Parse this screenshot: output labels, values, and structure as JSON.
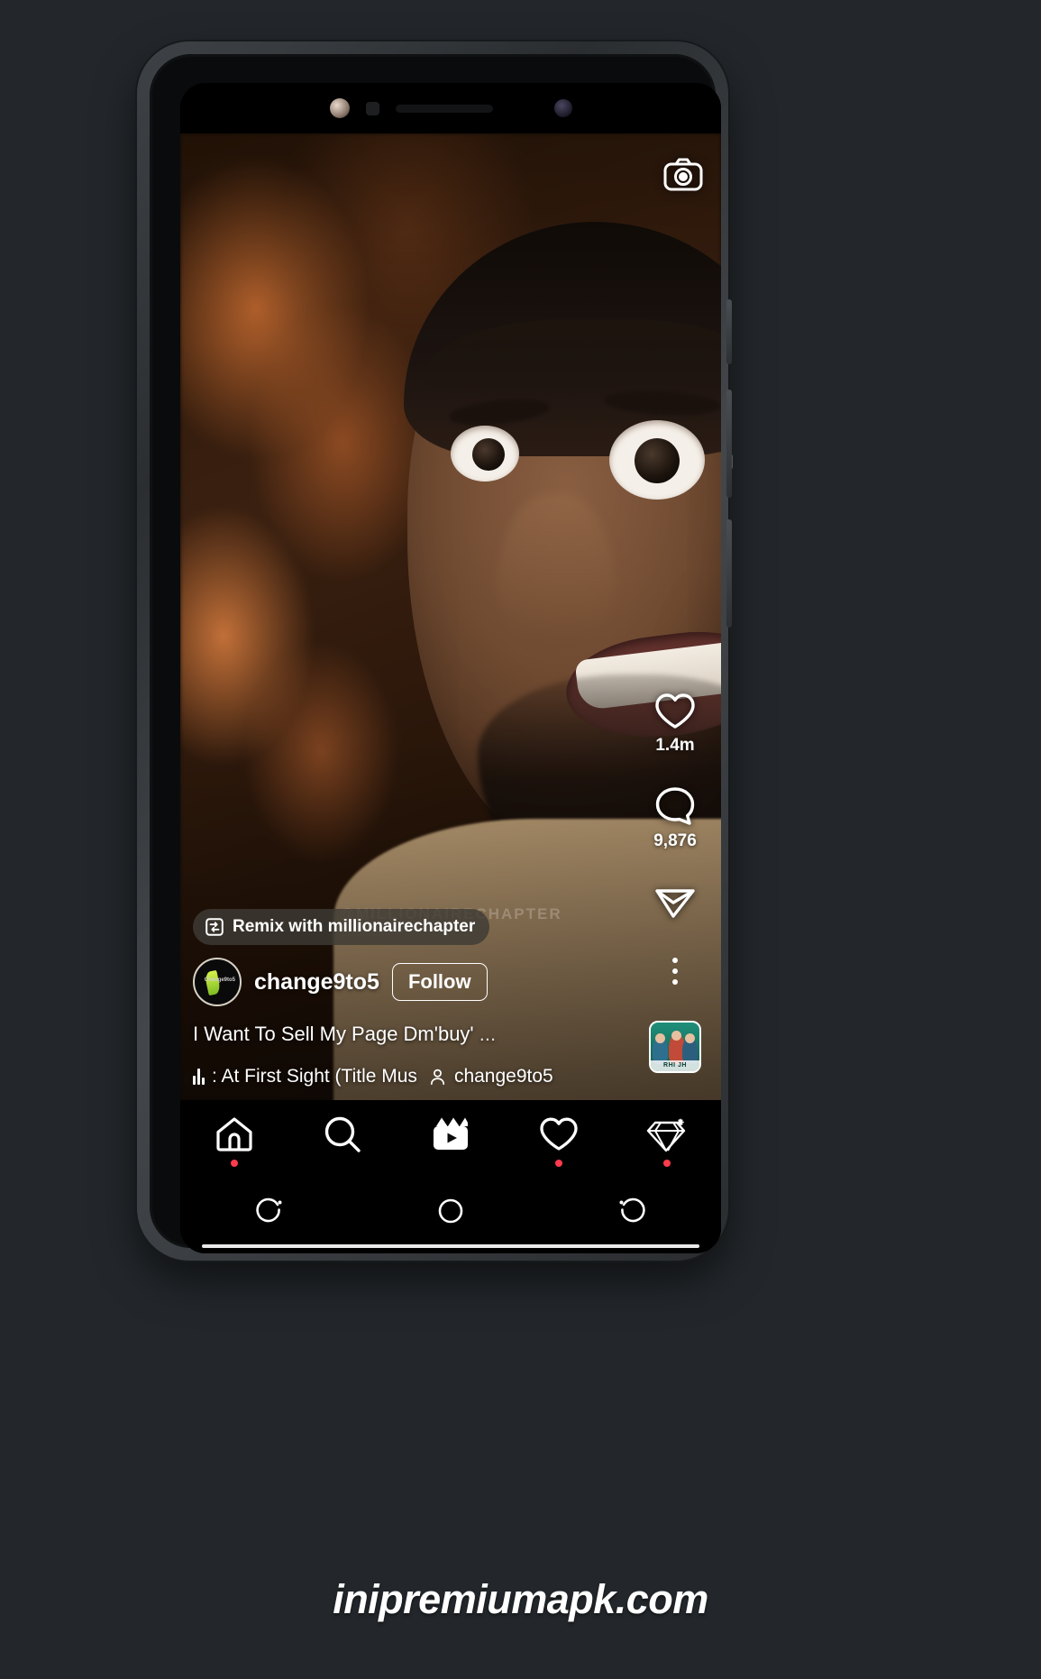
{
  "page": {
    "background_color": "#23272b",
    "site_watermark": "inipremiumapk.com"
  },
  "phone": {
    "status_icons": [
      "front-camera",
      "proximity-sensor",
      "earpiece-speaker",
      "secondary-camera"
    ]
  },
  "reel": {
    "center_watermark": "@MILLIONAIRECHAPTER",
    "camera_button_label": "camera-icon",
    "remix": {
      "icon": "remix-icon",
      "label": "Remix with millionairechapter"
    },
    "author": {
      "avatar_label": "Change9to5",
      "username": "change9to5",
      "follow_label": "Follow"
    },
    "caption": {
      "text": "I Want To Sell My Page Dm'buy'",
      "more": "..."
    },
    "audio": {
      "title": ": At First Sight (Title Mus",
      "attribution": "change9to5"
    },
    "actions": {
      "like": {
        "icon": "heart-icon",
        "count": "1.4m"
      },
      "comment": {
        "icon": "comment-icon",
        "count": "9,876"
      },
      "share": {
        "icon": "share-icon",
        "count": ""
      },
      "more": {
        "icon": "more-options-icon"
      },
      "audio_thumbnail": {
        "icon": "audio-thumbnail",
        "caption": "RHI JH"
      }
    }
  },
  "tabbar": {
    "items": [
      {
        "name": "home",
        "icon": "home-icon",
        "badge": true
      },
      {
        "name": "search",
        "icon": "search-icon",
        "badge": false
      },
      {
        "name": "reels",
        "icon": "reels-icon",
        "badge": false
      },
      {
        "name": "activity",
        "icon": "heart-icon",
        "badge": true
      },
      {
        "name": "shop",
        "icon": "diamond-icon",
        "badge": true
      }
    ]
  },
  "androidnav": {
    "items": [
      {
        "name": "back",
        "icon": "back-icon"
      },
      {
        "name": "home",
        "icon": "circle-home-icon"
      },
      {
        "name": "recents",
        "icon": "recents-icon"
      }
    ]
  },
  "colors": {
    "accent_badge": "#ff3b4e",
    "overlay_pill": "rgba(62,58,52,0.82)",
    "text_primary": "#ffffff"
  }
}
